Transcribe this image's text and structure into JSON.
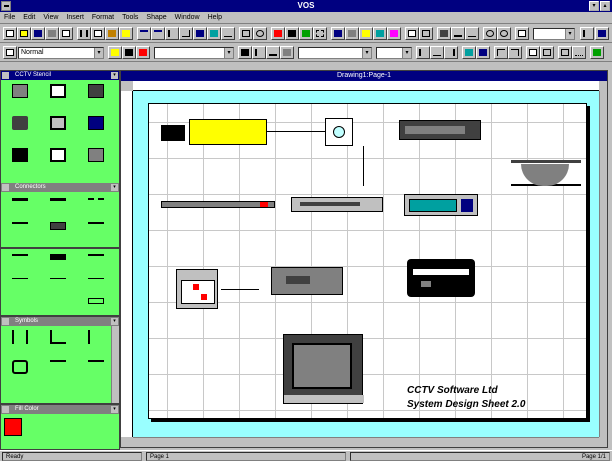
{
  "window": {
    "title": "VOS"
  },
  "menu": [
    "File",
    "Edit",
    "View",
    "Insert",
    "Format",
    "Tools",
    "Shape",
    "Window",
    "Help"
  ],
  "toolbar2": {
    "style_combo": "Normal",
    "font_combo": "",
    "size_combo": ""
  },
  "toolbar3": {
    "zoom_combo": "",
    "line_combo": ""
  },
  "stencils": [
    {
      "title": "CCTV Stencil",
      "active": true
    },
    {
      "title": "Connectors",
      "active": false
    },
    {
      "title": "Symbols",
      "active": false
    },
    {
      "title": "Fill Color",
      "active": false
    }
  ],
  "drawing": {
    "title": "Drawing1:Page-1",
    "footer_line1": "CCTV Software Ltd",
    "footer_line2": "System Design Sheet 2.0"
  },
  "status": {
    "left": "Ready",
    "page": "Page 1",
    "right": "Page 1/1"
  },
  "colors": {
    "titlebar": "#000080",
    "stencil_bg": "#66ff66",
    "canvas_bg": "#99ffff",
    "accent_yellow": "#ffff00",
    "accent_red": "#ff0000"
  }
}
